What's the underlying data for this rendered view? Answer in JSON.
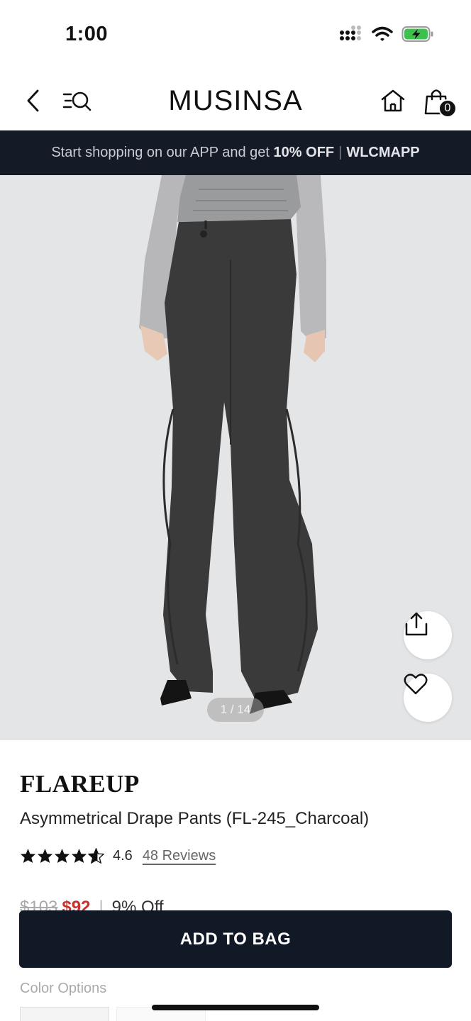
{
  "status_bar": {
    "time": "1:00"
  },
  "nav": {
    "logo": "MUSINSA",
    "bag_count": "0"
  },
  "promo": {
    "text": "Start shopping on our APP and get ",
    "highlight": "10% OFF",
    "separator": "|",
    "code": "WLCMAPP"
  },
  "hero": {
    "pager": "1 / 14",
    "background_color": "#e4e5e6"
  },
  "product": {
    "brand": "FLAREUP",
    "name": "Asymmetrical Drape Pants (FL-245_Charcoal)",
    "rating": "4.6",
    "rating_stars_value": 4.6,
    "reviews_label": "48 Reviews",
    "old_price": "$103",
    "new_price": "$92",
    "price_separator": "|",
    "discount": "9% Off"
  },
  "actions": {
    "add_to_bag": "ADD TO BAG"
  },
  "options": {
    "color_label": "Color Options"
  },
  "colors": {
    "promo_bg": "#141a26",
    "button_bg": "#111826",
    "sale_red": "#c9302c"
  },
  "icons": [
    "back-icon",
    "menu-search-icon",
    "home-icon",
    "bag-icon",
    "share-icon",
    "heart-icon",
    "star-icon",
    "signal-icon",
    "wifi-icon",
    "battery-icon"
  ]
}
